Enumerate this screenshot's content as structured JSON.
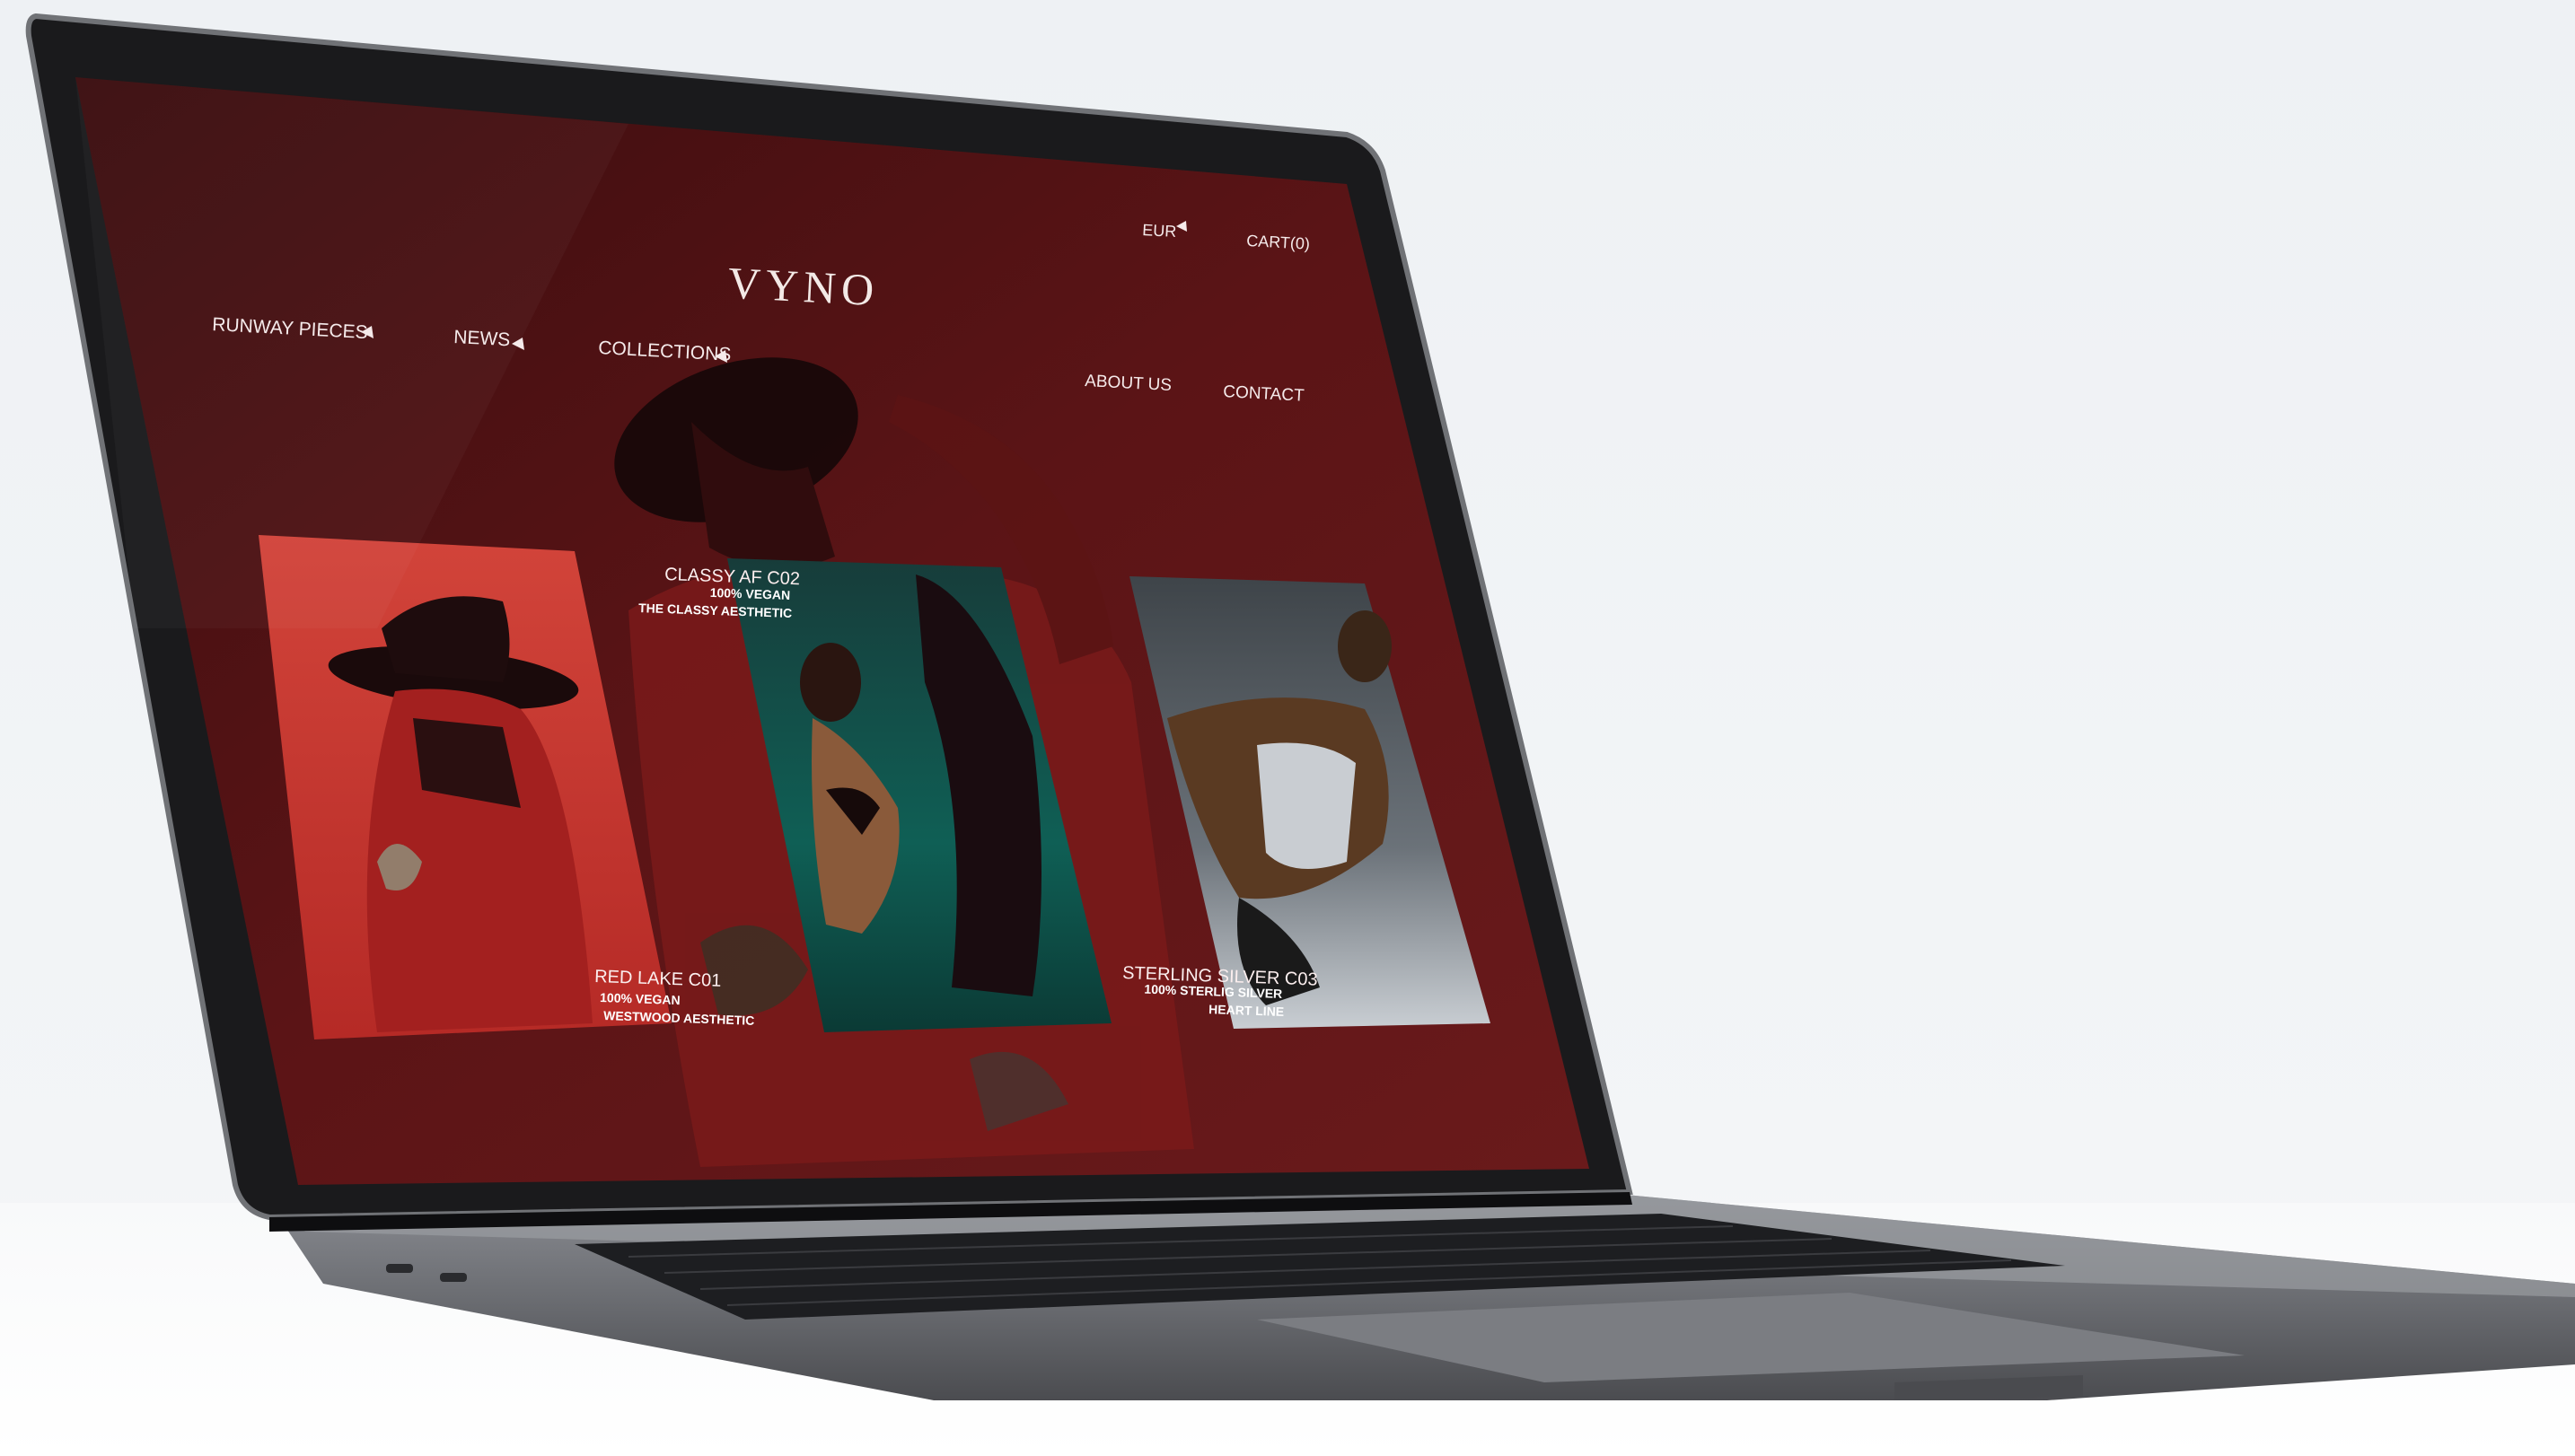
{
  "site": {
    "logo": "VYNO",
    "currency": {
      "label": "EUR",
      "icon": "caret-left-icon"
    },
    "cart": "CART(0)"
  },
  "nav": {
    "left": [
      {
        "label": "RUNWAY PIECES",
        "icon": "caret-left-icon"
      },
      {
        "label": "NEWS",
        "icon": "caret-left-icon"
      },
      {
        "label": "COLLECTIONS",
        "icon": "caret-left-icon"
      }
    ],
    "right": [
      {
        "label": "ABOUT US"
      },
      {
        "label": "CONTACT"
      }
    ]
  },
  "products": [
    {
      "title": "RED LAKE C01",
      "line1": "100% VEGAN",
      "line2": "WESTWOOD AESTHETIC"
    },
    {
      "title": "CLASSY AF C02",
      "line1": "100% VEGAN",
      "line2": "THE CLASSY AESTHETIC"
    },
    {
      "title": "STERLING SILVER C03",
      "line1": "100% STERLIG SILVER",
      "line2": "HEART LINE"
    }
  ],
  "colors": {
    "background": "#5a1314",
    "accent_red": "#c7352e",
    "text": "#f5eaea",
    "laptop_body": "#5e5f64"
  }
}
